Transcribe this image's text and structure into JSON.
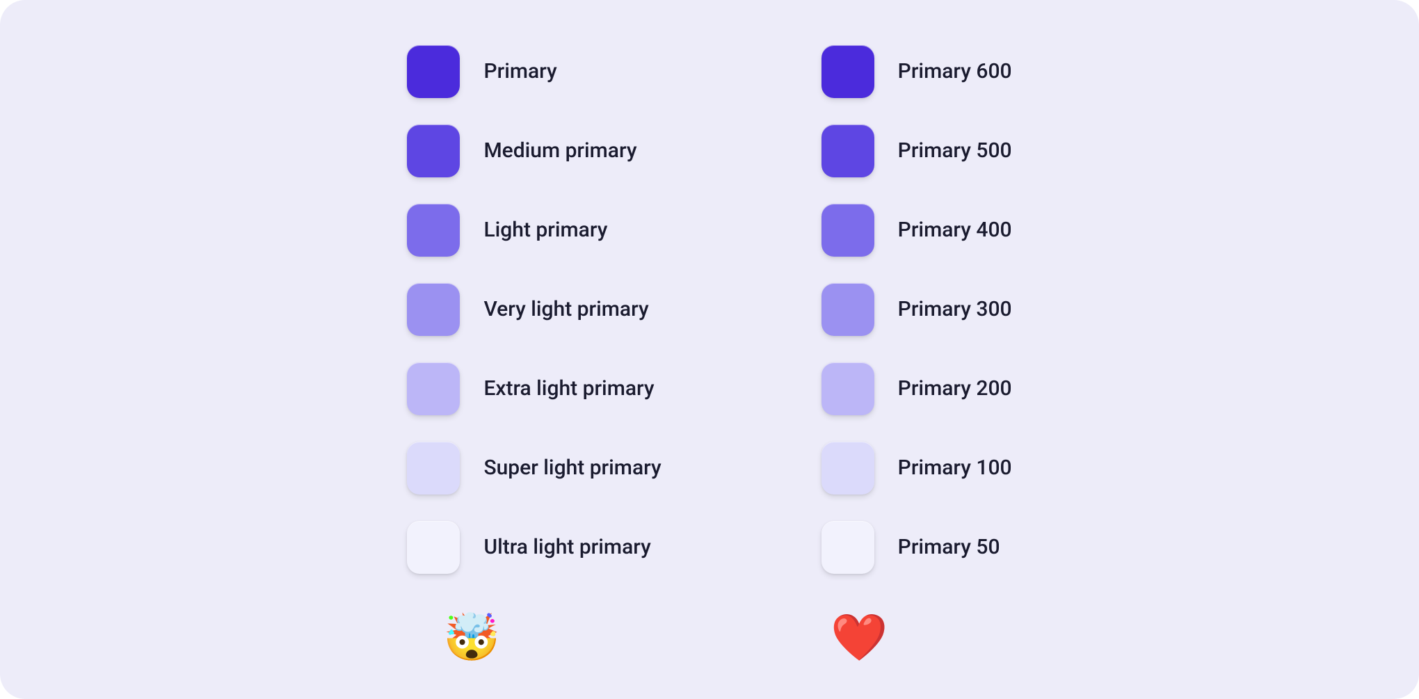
{
  "columns": [
    {
      "id": "bad-naming",
      "emoji": "🤯",
      "swatches": [
        {
          "label": "Primary",
          "color": "#4B2BDC"
        },
        {
          "label": "Medium primary",
          "color": "#5E46E3"
        },
        {
          "label": "Light primary",
          "color": "#7C6CEB"
        },
        {
          "label": "Very light primary",
          "color": "#9B91F1"
        },
        {
          "label": "Extra light primary",
          "color": "#BCB6F7"
        },
        {
          "label": "Super light primary",
          "color": "#DBDAFB"
        },
        {
          "label": "Ultra light primary",
          "color": "#F2F2FD"
        }
      ]
    },
    {
      "id": "good-naming",
      "emoji": "❤️",
      "swatches": [
        {
          "label": "Primary 600",
          "color": "#4B2BDC"
        },
        {
          "label": "Primary 500",
          "color": "#5E46E3"
        },
        {
          "label": "Primary 400",
          "color": "#7C6CEB"
        },
        {
          "label": "Primary 300",
          "color": "#9B91F1"
        },
        {
          "label": "Primary 200",
          "color": "#BCB6F7"
        },
        {
          "label": "Primary 100",
          "color": "#DBDAFB"
        },
        {
          "label": "Primary 50",
          "color": "#F2F2FD"
        }
      ]
    }
  ]
}
